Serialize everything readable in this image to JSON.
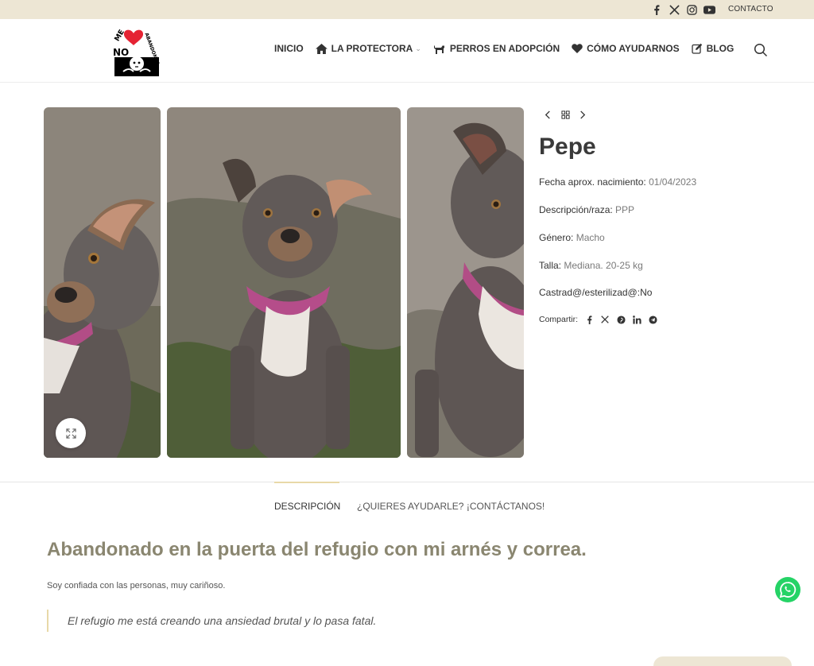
{
  "topbar": {
    "social_icons": [
      "facebook-icon",
      "x-icon",
      "instagram-icon",
      "youtube-icon"
    ],
    "contact_label": "CONTACTO"
  },
  "header": {
    "logo_alt": "No me abandones",
    "nav": [
      {
        "label": "INICIO",
        "icon": ""
      },
      {
        "label": "LA PROTECTORA",
        "icon": "home-icon",
        "dropdown": true
      },
      {
        "label": "PERROS EN ADOPCIÓN",
        "icon": "dog-icon"
      },
      {
        "label": "CÓMO AYUDARNOS",
        "icon": "heart-icon"
      },
      {
        "label": "BLOG",
        "icon": "edit-icon"
      }
    ],
    "search_icon": "search-icon"
  },
  "product": {
    "name": "Pepe",
    "attributes": [
      {
        "label": "Fecha aprox. nacimiento:",
        "value": "01/04/2023"
      },
      {
        "label": "Descripción/raza:",
        "value": "PPP"
      },
      {
        "label": "Género:",
        "value": "Macho"
      },
      {
        "label": "Talla:",
        "value": "Mediana. 20-25 kg"
      },
      {
        "label": "Castrad@/esterilizad@:",
        "value": "No"
      }
    ],
    "share_label": "Compartir:",
    "share_icons": [
      "facebook-icon",
      "x-icon",
      "pinterest-icon",
      "linkedin-icon",
      "telegram-icon"
    ]
  },
  "tabs": [
    {
      "label": "DESCRIPCIÓN",
      "active": true
    },
    {
      "label": "¿QUIERES AYUDARLE? ¡CONTÁCTANOS!",
      "active": false
    }
  ],
  "description": {
    "heading": "Abandonado en la puerta del refugio con mi arnés y correa.",
    "paragraph": "Soy confiada con las personas, muy cariñoso.",
    "quote": "El refugio me está creando una ansiedad brutal y lo pasa fatal."
  },
  "colors": {
    "topbar_bg": "#ede6d4",
    "accent": "#e8d9a8",
    "heading": "#8a8670",
    "whatsapp": "#25d366"
  }
}
